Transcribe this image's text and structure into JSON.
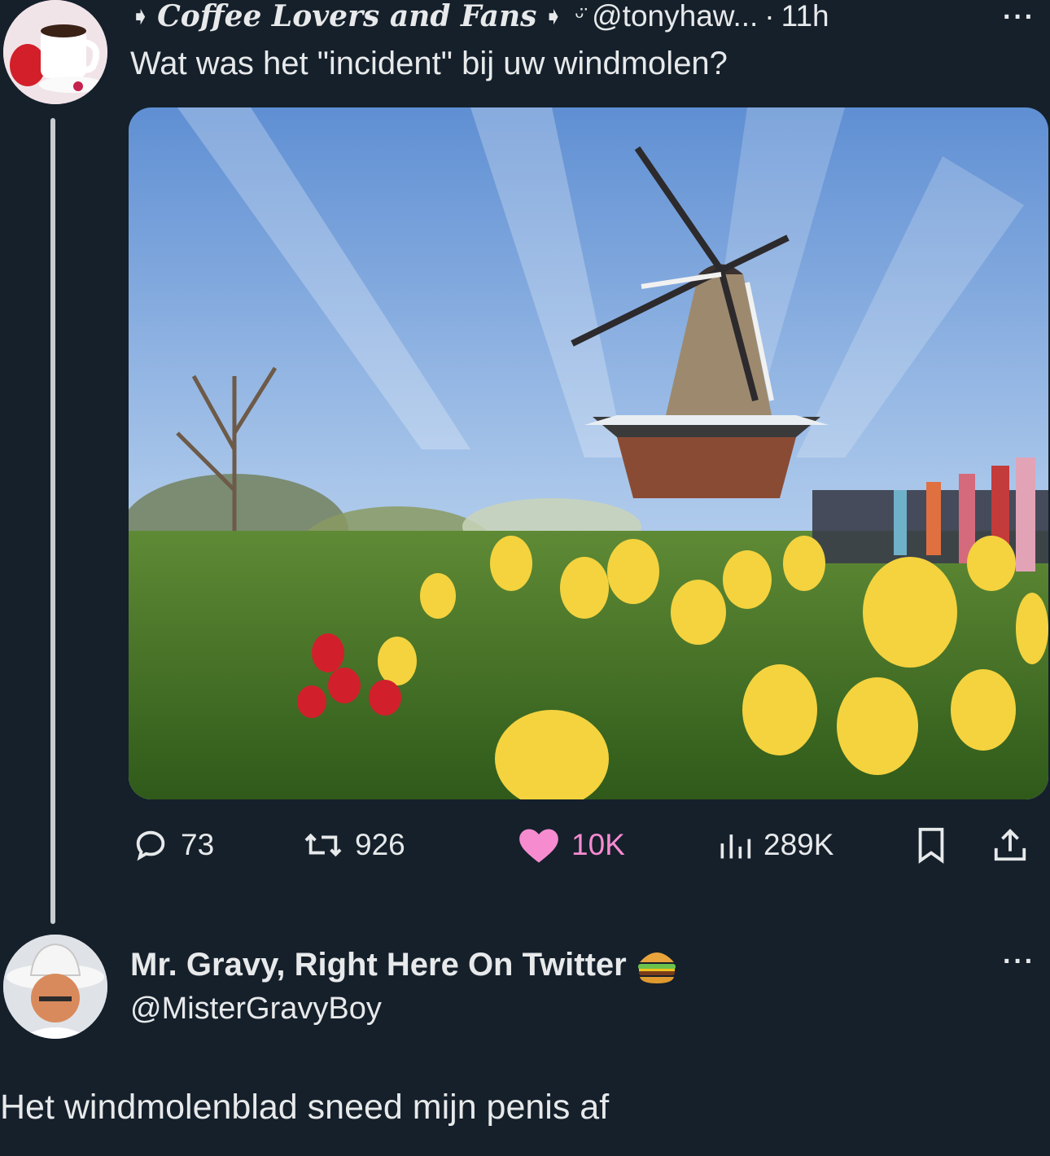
{
  "tweet": {
    "display_name": "Coffee Lovers and Fans",
    "handle": "@tonyhaw...",
    "separator": "·",
    "time": "11h",
    "more": "···",
    "text": "Wat was het \"incident\" bij uw windmolen?",
    "media_icon": "windmill-photo",
    "stats": {
      "replies": "73",
      "retweets": "926",
      "likes": "10K",
      "views": "289K"
    },
    "icons": [
      "coffee-cup-avatar",
      "reply-icon",
      "retweet-icon",
      "heart-icon",
      "views-icon",
      "bookmark-icon",
      "share-icon"
    ],
    "like_color": "#f91880"
  },
  "reply": {
    "display_name": "Mr. Gravy, Right Here On Twitter",
    "emoji": "hamburger-emoji",
    "handle": "@MisterGravyBoy",
    "more": "···",
    "text": "Het windmolenblad sneed mijn penis af"
  },
  "theme": {
    "background": "#15202b",
    "text": "#e7e9ea"
  }
}
